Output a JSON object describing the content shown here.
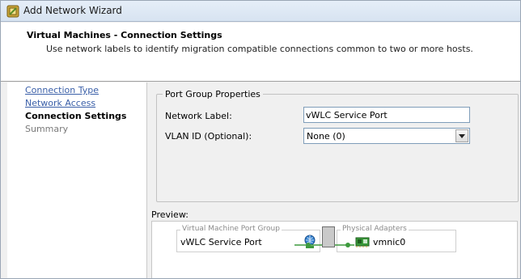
{
  "window": {
    "title": "Add Network Wizard",
    "icon": "network-wizard-icon"
  },
  "header": {
    "title": "Virtual Machines - Connection Settings",
    "subtitle": "Use network labels to identify migration compatible connections common to two or more hosts."
  },
  "steps": [
    {
      "label": "Connection Type",
      "state": "link"
    },
    {
      "label": "Network Access",
      "state": "link"
    },
    {
      "label": "Connection Settings",
      "state": "current"
    },
    {
      "label": "Summary",
      "state": "pending"
    }
  ],
  "port_group": {
    "legend": "Port Group Properties",
    "network_label": {
      "label": "Network Label:",
      "value": "vWLC Service Port"
    },
    "vlan": {
      "label": "VLAN ID (Optional):",
      "value": "None (0)"
    }
  },
  "preview": {
    "label": "Preview:",
    "vm_group_caption": "Virtual Machine Port Group",
    "vm_group_value": "vWLC Service Port",
    "adapters_caption": "Physical Adapters",
    "adapter_value": "vmnic0"
  },
  "colors": {
    "link": "#3a5fa8",
    "connector": "#3d9a3d"
  }
}
